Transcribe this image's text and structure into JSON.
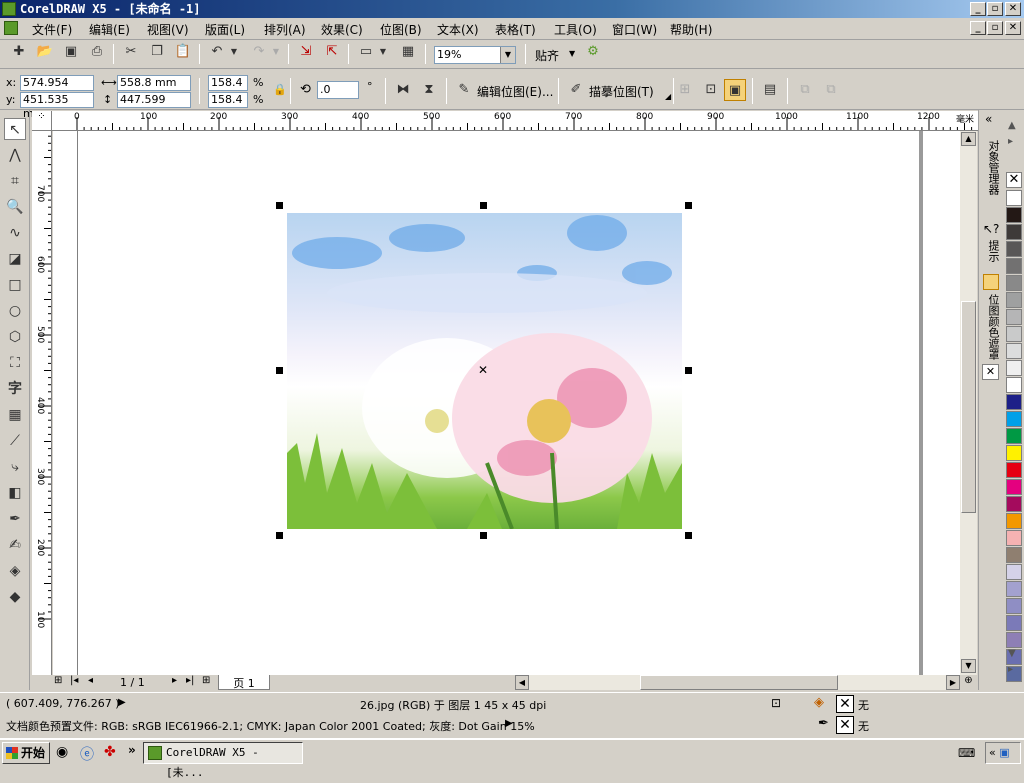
{
  "window": {
    "title": "CorelDRAW X5 - [未命名 -1]"
  },
  "menu": [
    "文件(F)",
    "编辑(E)",
    "视图(V)",
    "版面(L)",
    "排列(A)",
    "效果(C)",
    "位图(B)",
    "文本(X)",
    "表格(T)",
    "工具(O)",
    "窗口(W)",
    "帮助(H)"
  ],
  "toolbar": {
    "zoom": "19%",
    "snap": "贴齐"
  },
  "property_bar": {
    "x_label": "x:",
    "x_value": "574.954 mm",
    "y_label": "y:",
    "y_value": "451.535 mm",
    "w_value": "558.8 mm",
    "h_value": "447.599 mm",
    "scale_x": "158.4",
    "scale_y": "158.4",
    "pct": "%",
    "rotation": ".0",
    "deg": "°",
    "edit_bitmap": "编辑位图(E)...",
    "trace_bitmap": "描摹位图(T)"
  },
  "ruler": {
    "h_ticks": [
      "0",
      "100",
      "200",
      "300",
      "400",
      "500",
      "600",
      "700",
      "800",
      "900",
      "1000",
      "1100",
      "1200"
    ],
    "h_unit": "毫米",
    "v_ticks": [
      "700",
      "600",
      "500",
      "400",
      "300",
      "200",
      "100"
    ]
  },
  "pages": {
    "counter": "1 / 1",
    "tab": "页 1"
  },
  "dockers": {
    "object_manager": "对象管理器",
    "hints": "提示",
    "bitmap_mask": "位图颜色遮罩"
  },
  "palette": [
    "#ffffff",
    "#231815",
    "#3e3a39",
    "#595757",
    "#727171",
    "#898989",
    "#9fa0a0",
    "#b5b5b6",
    "#c9caca",
    "#dcdddd",
    "#efefef",
    "#ffffff",
    "#1d2088",
    "#00a0e9",
    "#009944",
    "#fff100",
    "#e60012",
    "#e4007f",
    "#a40b5d",
    "#f39800",
    "#f5b2b2",
    "#8f7f70",
    "#d5d2e8",
    "#a3a1cf",
    "#8f8ec4",
    "#7b7ab8",
    "#8e7fb5",
    "#6a6fb0",
    "#5a6aa0"
  ],
  "status": {
    "coords": "( 607.409, 776.267 )",
    "object_info": "26.jpg (RGB) 于 图层 1 45 x 45 dpi",
    "fill_label": "无",
    "outline_label": "无",
    "color_profile": "文档颜色预置文件: RGB: sRGB IEC61966-2.1; CMYK: Japan Color 2001 Coated; 灰度: Dot Gain 15%"
  },
  "taskbar": {
    "start": "开始",
    "task": "CorelDRAW X5 - [未..."
  }
}
